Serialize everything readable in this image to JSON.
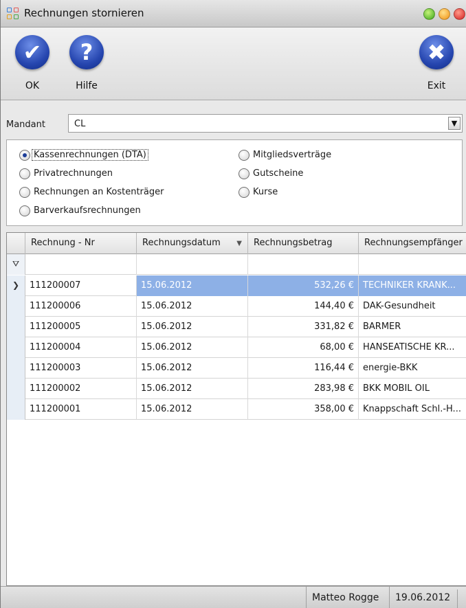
{
  "window": {
    "title": "Rechnungen stornieren"
  },
  "toolbar": {
    "ok_label": "OK",
    "help_label": "Hilfe",
    "exit_label": "Exit"
  },
  "mandant": {
    "label": "Mandant",
    "value": "CL"
  },
  "radio_options": [
    {
      "label": "Kassenrechnungen (DTA)",
      "checked": true
    },
    {
      "label": "Privatrechnungen",
      "checked": false
    },
    {
      "label": "Rechnungen an Kostenträger",
      "checked": false
    },
    {
      "label": "Barverkaufsrechnungen",
      "checked": false
    },
    {
      "label": "Mitgliedsverträge",
      "checked": false
    },
    {
      "label": "Gutscheine",
      "checked": false
    },
    {
      "label": "Kurse",
      "checked": false
    }
  ],
  "grid": {
    "columns": [
      "Rechnung - Nr",
      "Rechnungsdatum",
      "Rechnungsbetrag",
      "Rechnungsempfänger"
    ],
    "sorted_column": "Rechnungsdatum",
    "rows": [
      {
        "nr": "111200007",
        "datum": "15.06.2012",
        "betrag": "532,26 €",
        "empfaenger": "TECHNIKER KRANK...",
        "selected": true
      },
      {
        "nr": "111200006",
        "datum": "15.06.2012",
        "betrag": "144,40 €",
        "empfaenger": "DAK-Gesundheit"
      },
      {
        "nr": "111200005",
        "datum": "15.06.2012",
        "betrag": "331,82 €",
        "empfaenger": "BARMER"
      },
      {
        "nr": "111200004",
        "datum": "15.06.2012",
        "betrag": "68,00 €",
        "empfaenger": "HANSEATISCHE KR..."
      },
      {
        "nr": "111200003",
        "datum": "15.06.2012",
        "betrag": "116,44 €",
        "empfaenger": "energie-BKK"
      },
      {
        "nr": "111200002",
        "datum": "15.06.2012",
        "betrag": "283,98 €",
        "empfaenger": "BKK MOBIL OIL"
      },
      {
        "nr": "111200001",
        "datum": "15.06.2012",
        "betrag": "358,00 €",
        "empfaenger": "Knappschaft Schl.-H..."
      }
    ]
  },
  "status": {
    "user": "Matteo Rogge",
    "date": "19.06.2012"
  },
  "colors": {
    "selection": "#8db0e6",
    "button_blue": "#2747b0"
  }
}
